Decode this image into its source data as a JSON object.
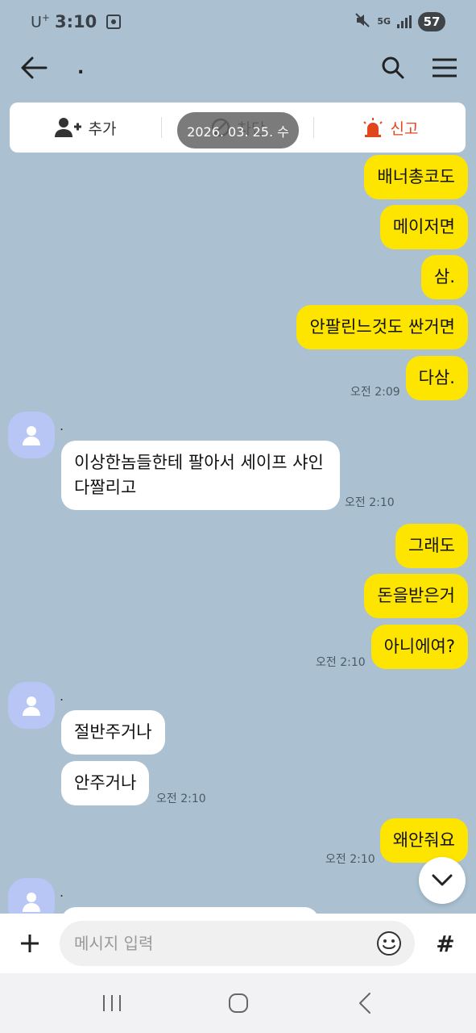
{
  "status_bar": {
    "carrier": "U",
    "carrier_plus": "+",
    "time": "3:10",
    "network": "5G",
    "battery": "57"
  },
  "app_bar": {
    "title": "."
  },
  "action_card": {
    "add_label": "추가",
    "block_label": "차단",
    "report_label": "신고"
  },
  "date_pill": "2026. 03. 25. 수",
  "messages": [
    {
      "side": "me",
      "text": "배너총코도"
    },
    {
      "side": "me",
      "text": "메이저면"
    },
    {
      "side": "me",
      "text": "삼."
    },
    {
      "side": "me",
      "text": "안팔린느것도 싼거면"
    },
    {
      "side": "me",
      "text": "다삼."
    },
    {
      "time": "오전 2:09"
    },
    {
      "sender": "."
    },
    {
      "side": "them",
      "text": "이상한놈들한테 팔아서 세이프 샤인 다짤리고"
    },
    {
      "time": "오전 2:10"
    },
    {
      "side": "me",
      "text": "그래도"
    },
    {
      "side": "me",
      "text": "돈을받은거"
    },
    {
      "side": "me",
      "text": "아니에여?"
    },
    {
      "time": "오전 2:10"
    },
    {
      "sender": "."
    },
    {
      "side": "them",
      "text": "절반주거나"
    },
    {
      "side": "them",
      "text": "안주거나"
    },
    {
      "time": "오전 2:10"
    },
    {
      "side": "me",
      "text": "왜안줘요"
    },
    {
      "time": "오전 2:10"
    },
    {
      "sender": "."
    }
  ],
  "input": {
    "placeholder": "메시지 입력"
  },
  "colors": {
    "background": "#abc1d1",
    "my_bubble": "#fee500",
    "their_bubble": "#ffffff",
    "report": "#e0471d"
  },
  "icons": [
    "back-arrow-icon",
    "search-icon",
    "menu-icon",
    "add-friend-icon",
    "block-icon",
    "siren-icon",
    "chevron-down-icon",
    "plus-icon",
    "emoji-icon",
    "hash-icon",
    "recents-icon",
    "home-icon",
    "nav-back-icon"
  ]
}
